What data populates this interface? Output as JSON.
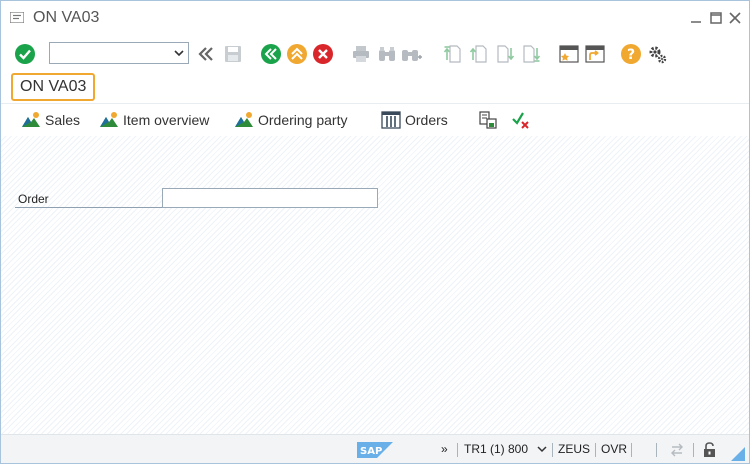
{
  "window": {
    "title": "ON VA03"
  },
  "toolbar": {
    "command_field_value": "",
    "icons": [
      "enter-check-icon",
      "command-dropdown-icon",
      "collapse-icon",
      "save-icon",
      "back-icon",
      "exit-icon",
      "cancel-icon",
      "print-icon",
      "find-icon",
      "find-next-icon",
      "first-page-icon",
      "previous-page-icon",
      "next-page-icon",
      "last-page-icon",
      "create-session-icon",
      "generate-shortcut-icon",
      "help-icon",
      "customize-layout-icon"
    ]
  },
  "transaction": {
    "code": "ON VA03"
  },
  "app_toolbar": {
    "sales": "Sales",
    "item_overview": "Item overview",
    "ordering_party": "Ordering party",
    "orders": "Orders"
  },
  "form": {
    "order_label": "Order",
    "order_value": ""
  },
  "statusbar": {
    "expand": "»",
    "system": "TR1 (1) 800",
    "server": "ZEUS",
    "mode": "OVR"
  },
  "colors": {
    "accent_orange": "#f0a830",
    "green": "#1aa34a",
    "red": "#d9262b",
    "sap_blue": "#6ab0e8"
  }
}
